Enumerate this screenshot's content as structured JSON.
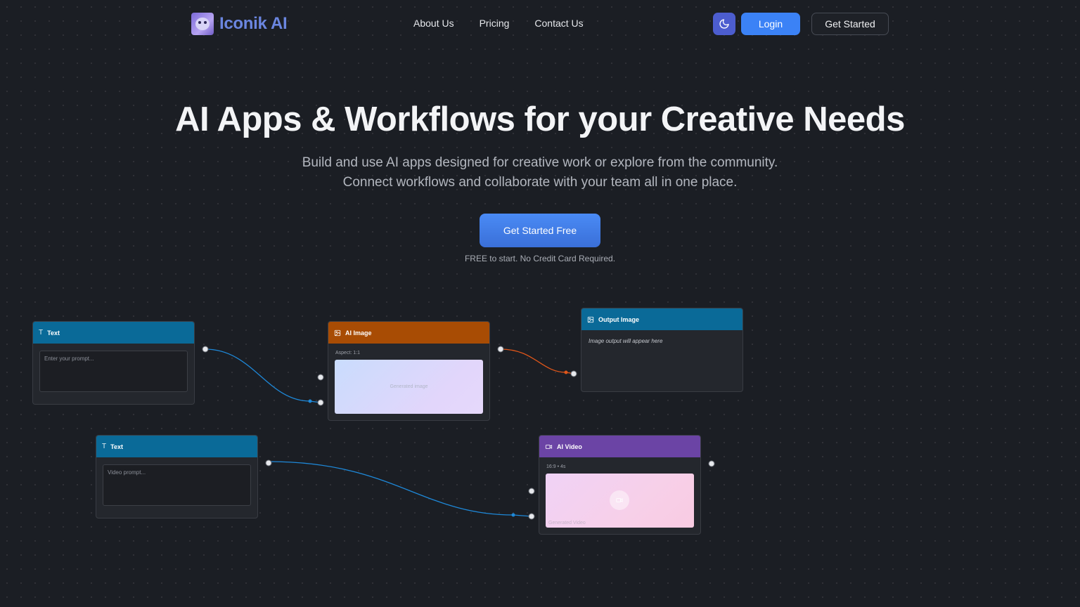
{
  "brand": {
    "name": "Iconik AI",
    "logo_icon": "robot-mascot-icon"
  },
  "nav": {
    "links": [
      "About Us",
      "Pricing",
      "Contact Us"
    ]
  },
  "header_actions": {
    "theme_icon": "moon-icon",
    "login": "Login",
    "get_started": "Get Started"
  },
  "hero": {
    "title": "AI Apps & Workflows for your Creative Needs",
    "subtitle_line1": "Build and use AI apps designed for creative work or explore from the community.",
    "subtitle_line2": "Connect workflows and collaborate with your team all in one place.",
    "cta": "Get Started Free",
    "note": "FREE to start. No Credit Card Required."
  },
  "workflow": {
    "text_node_1": {
      "title": "Text",
      "placeholder": "Enter your prompt..."
    },
    "ai_image_node": {
      "title": "AI Image",
      "meta": "Aspect: 1:1",
      "preview": "Generated image"
    },
    "output_image_node": {
      "title": "Output Image",
      "message": "Image output will appear here"
    },
    "text_node_2": {
      "title": "Text",
      "placeholder": "Video prompt..."
    },
    "ai_video_node": {
      "title": "AI Video",
      "meta": "16:9 • 4s",
      "preview": "Generated Video"
    }
  },
  "colors": {
    "background": "#1b1e24",
    "accent": "#3b82f6",
    "brand": "#6b86e0",
    "text_header": "#0a6a98",
    "image_header": "#a84c04",
    "video_header": "#6b44a5",
    "wire_blue": "#1e88d8",
    "wire_orange": "#e0561a"
  }
}
